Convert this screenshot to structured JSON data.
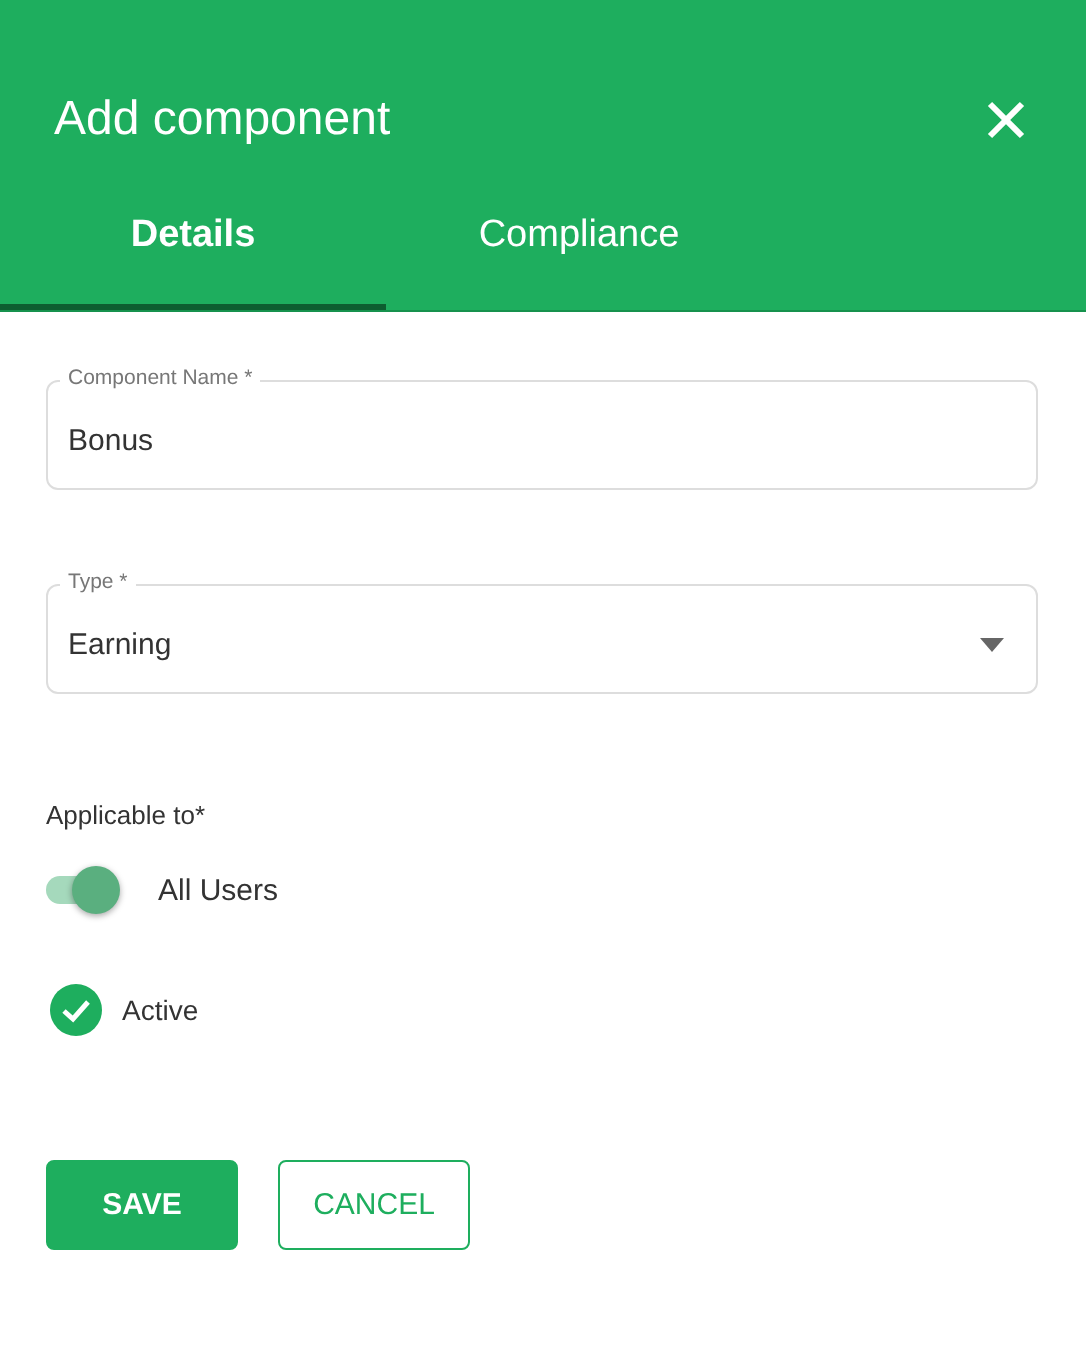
{
  "dialog": {
    "title": "Add component"
  },
  "tabs": [
    {
      "label": "Details",
      "selected": true
    },
    {
      "label": "Compliance",
      "selected": false
    }
  ],
  "fields": [
    {
      "kind": "text",
      "label": "Component Name *",
      "value": "Bonus"
    },
    {
      "kind": "select",
      "label": "Type *",
      "value": "Earning"
    }
  ],
  "applicable": {
    "label": "Applicable to*",
    "toggle_label": "All Users",
    "on": true
  },
  "active": {
    "label": "Active",
    "checked": true
  },
  "buttons": [
    {
      "kind": "primary",
      "label": "SAVE"
    },
    {
      "kind": "outline",
      "label": "CANCEL"
    }
  ]
}
